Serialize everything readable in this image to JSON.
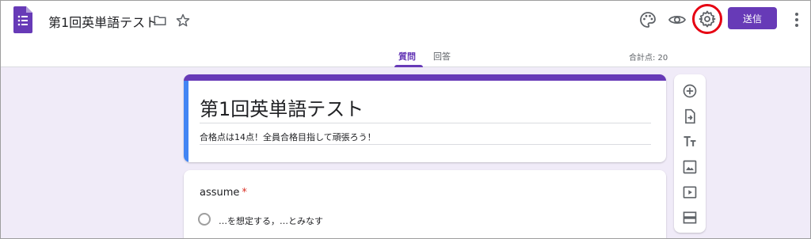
{
  "header": {
    "doc_title": "第1回英単語テスト",
    "send_label": "送信",
    "icons": [
      "forms-logo-icon",
      "folder-icon",
      "star-icon",
      "palette-icon",
      "eye-icon",
      "gear-icon",
      "more-vert-icon"
    ],
    "highlight_color": "#e60012"
  },
  "tabs": {
    "questions": "質問",
    "responses": "回答",
    "total_points": "合計点: 20"
  },
  "form": {
    "title": "第1回英単語テスト",
    "description": "合格点は14点！全員合格目指して頑張ろう！"
  },
  "question": {
    "text": "assume",
    "required_mark": "*",
    "option_1": "…を想定する，…とみなす"
  },
  "toolbar": {
    "items": [
      "add-question-icon",
      "import-questions-icon",
      "add-title-icon",
      "add-image-icon",
      "add-video-icon",
      "add-section-icon"
    ]
  },
  "colors": {
    "accent": "#673ab7",
    "background": "#f0ebf8",
    "title_left_bar": "#4285f4"
  }
}
